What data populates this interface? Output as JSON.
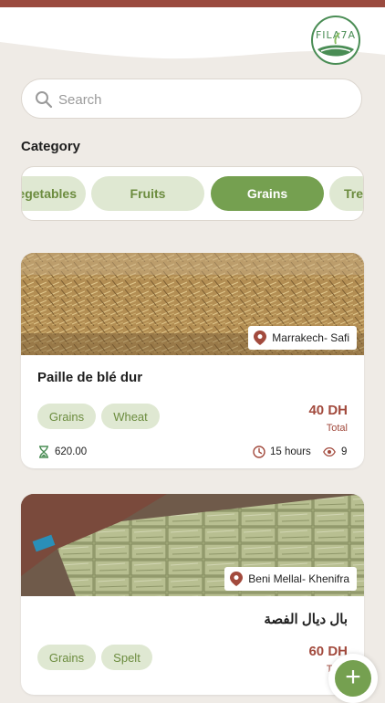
{
  "brand": {
    "logo_text": "FILA7A"
  },
  "search": {
    "placeholder": "Search"
  },
  "categories": {
    "title": "Category",
    "items": [
      {
        "label": "Vegetables"
      },
      {
        "label": "Fruits"
      },
      {
        "label": "Grains",
        "selected": true
      },
      {
        "label": "Trees"
      }
    ]
  },
  "listings": [
    {
      "location": "Marrakech- Safi",
      "title": "Paille de blé dur",
      "tags": [
        "Grains",
        "Wheat"
      ],
      "price": "40 DH",
      "price_note": "Total",
      "quantity": "620.00",
      "time_ago": "15 hours",
      "views": "9"
    },
    {
      "location": "Beni Mellal- Khenifra",
      "title": "بال ديال الفصة",
      "tags": [
        "Grains",
        "Spelt"
      ],
      "price": "60 DH",
      "price_note": "Total"
    }
  ],
  "colors": {
    "accent": "#75a050",
    "brand_bar": "#9a4a3f",
    "price": "#a24a3d",
    "background": "#efebe6"
  },
  "icons": [
    "search-icon",
    "location-pin-icon",
    "hourglass-icon",
    "clock-icon",
    "eye-icon",
    "plus-icon"
  ]
}
